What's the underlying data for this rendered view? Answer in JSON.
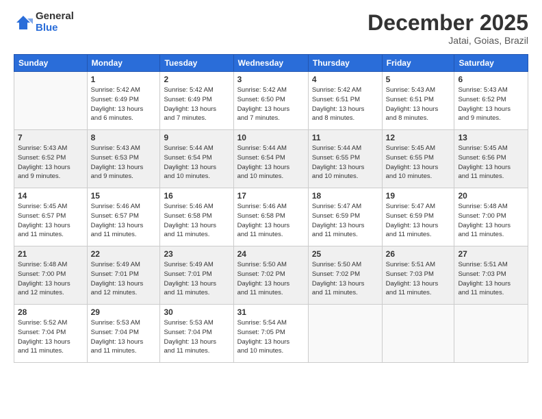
{
  "logo": {
    "general": "General",
    "blue": "Blue"
  },
  "title": "December 2025",
  "location": "Jatai, Goias, Brazil",
  "weekdays": [
    "Sunday",
    "Monday",
    "Tuesday",
    "Wednesday",
    "Thursday",
    "Friday",
    "Saturday"
  ],
  "weeks": [
    [
      {
        "day": "",
        "info": ""
      },
      {
        "day": "1",
        "info": "Sunrise: 5:42 AM\nSunset: 6:49 PM\nDaylight: 13 hours\nand 6 minutes."
      },
      {
        "day": "2",
        "info": "Sunrise: 5:42 AM\nSunset: 6:49 PM\nDaylight: 13 hours\nand 7 minutes."
      },
      {
        "day": "3",
        "info": "Sunrise: 5:42 AM\nSunset: 6:50 PM\nDaylight: 13 hours\nand 7 minutes."
      },
      {
        "day": "4",
        "info": "Sunrise: 5:42 AM\nSunset: 6:51 PM\nDaylight: 13 hours\nand 8 minutes."
      },
      {
        "day": "5",
        "info": "Sunrise: 5:43 AM\nSunset: 6:51 PM\nDaylight: 13 hours\nand 8 minutes."
      },
      {
        "day": "6",
        "info": "Sunrise: 5:43 AM\nSunset: 6:52 PM\nDaylight: 13 hours\nand 9 minutes."
      }
    ],
    [
      {
        "day": "7",
        "info": "Sunrise: 5:43 AM\nSunset: 6:52 PM\nDaylight: 13 hours\nand 9 minutes."
      },
      {
        "day": "8",
        "info": "Sunrise: 5:43 AM\nSunset: 6:53 PM\nDaylight: 13 hours\nand 9 minutes."
      },
      {
        "day": "9",
        "info": "Sunrise: 5:44 AM\nSunset: 6:54 PM\nDaylight: 13 hours\nand 10 minutes."
      },
      {
        "day": "10",
        "info": "Sunrise: 5:44 AM\nSunset: 6:54 PM\nDaylight: 13 hours\nand 10 minutes."
      },
      {
        "day": "11",
        "info": "Sunrise: 5:44 AM\nSunset: 6:55 PM\nDaylight: 13 hours\nand 10 minutes."
      },
      {
        "day": "12",
        "info": "Sunrise: 5:45 AM\nSunset: 6:55 PM\nDaylight: 13 hours\nand 10 minutes."
      },
      {
        "day": "13",
        "info": "Sunrise: 5:45 AM\nSunset: 6:56 PM\nDaylight: 13 hours\nand 11 minutes."
      }
    ],
    [
      {
        "day": "14",
        "info": "Sunrise: 5:45 AM\nSunset: 6:57 PM\nDaylight: 13 hours\nand 11 minutes."
      },
      {
        "day": "15",
        "info": "Sunrise: 5:46 AM\nSunset: 6:57 PM\nDaylight: 13 hours\nand 11 minutes."
      },
      {
        "day": "16",
        "info": "Sunrise: 5:46 AM\nSunset: 6:58 PM\nDaylight: 13 hours\nand 11 minutes."
      },
      {
        "day": "17",
        "info": "Sunrise: 5:46 AM\nSunset: 6:58 PM\nDaylight: 13 hours\nand 11 minutes."
      },
      {
        "day": "18",
        "info": "Sunrise: 5:47 AM\nSunset: 6:59 PM\nDaylight: 13 hours\nand 11 minutes."
      },
      {
        "day": "19",
        "info": "Sunrise: 5:47 AM\nSunset: 6:59 PM\nDaylight: 13 hours\nand 11 minutes."
      },
      {
        "day": "20",
        "info": "Sunrise: 5:48 AM\nSunset: 7:00 PM\nDaylight: 13 hours\nand 11 minutes."
      }
    ],
    [
      {
        "day": "21",
        "info": "Sunrise: 5:48 AM\nSunset: 7:00 PM\nDaylight: 13 hours\nand 12 minutes."
      },
      {
        "day": "22",
        "info": "Sunrise: 5:49 AM\nSunset: 7:01 PM\nDaylight: 13 hours\nand 12 minutes."
      },
      {
        "day": "23",
        "info": "Sunrise: 5:49 AM\nSunset: 7:01 PM\nDaylight: 13 hours\nand 11 minutes."
      },
      {
        "day": "24",
        "info": "Sunrise: 5:50 AM\nSunset: 7:02 PM\nDaylight: 13 hours\nand 11 minutes."
      },
      {
        "day": "25",
        "info": "Sunrise: 5:50 AM\nSunset: 7:02 PM\nDaylight: 13 hours\nand 11 minutes."
      },
      {
        "day": "26",
        "info": "Sunrise: 5:51 AM\nSunset: 7:03 PM\nDaylight: 13 hours\nand 11 minutes."
      },
      {
        "day": "27",
        "info": "Sunrise: 5:51 AM\nSunset: 7:03 PM\nDaylight: 13 hours\nand 11 minutes."
      }
    ],
    [
      {
        "day": "28",
        "info": "Sunrise: 5:52 AM\nSunset: 7:04 PM\nDaylight: 13 hours\nand 11 minutes."
      },
      {
        "day": "29",
        "info": "Sunrise: 5:53 AM\nSunset: 7:04 PM\nDaylight: 13 hours\nand 11 minutes."
      },
      {
        "day": "30",
        "info": "Sunrise: 5:53 AM\nSunset: 7:04 PM\nDaylight: 13 hours\nand 11 minutes."
      },
      {
        "day": "31",
        "info": "Sunrise: 5:54 AM\nSunset: 7:05 PM\nDaylight: 13 hours\nand 10 minutes."
      },
      {
        "day": "",
        "info": ""
      },
      {
        "day": "",
        "info": ""
      },
      {
        "day": "",
        "info": ""
      }
    ]
  ]
}
